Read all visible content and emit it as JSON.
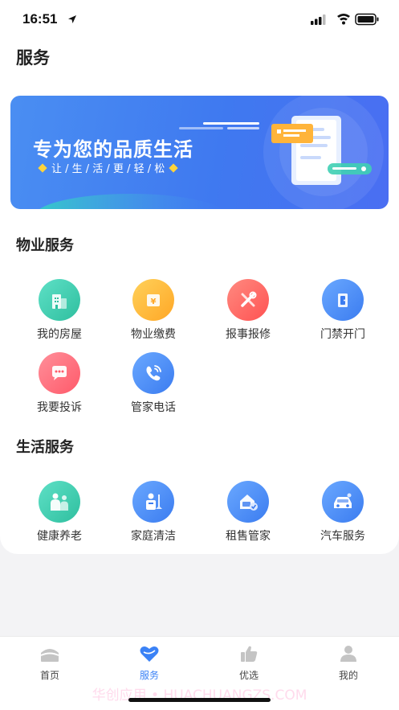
{
  "status": {
    "time": "16:51"
  },
  "page": {
    "title": "服务"
  },
  "banner": {
    "title": "专为您的品质生活",
    "subtitle": "让 / 生 / 活 / 更 / 轻 / 松"
  },
  "property_services": {
    "title": "物业服务",
    "items": [
      {
        "label": "我的房屋",
        "icon": "building-icon",
        "color": "#3fcfb4"
      },
      {
        "label": "物业缴费",
        "icon": "payment-icon",
        "color": "#ffb93a"
      },
      {
        "label": "报事报修",
        "icon": "repair-icon",
        "color": "#ff6b6b"
      },
      {
        "label": "门禁开门",
        "icon": "door-icon",
        "color": "#4a8ef2"
      },
      {
        "label": "我要投诉",
        "icon": "complaint-icon",
        "color": "#ff6b7a"
      },
      {
        "label": "管家电话",
        "icon": "phone-icon",
        "color": "#4a8ef2"
      }
    ]
  },
  "life_services": {
    "title": "生活服务",
    "items": [
      {
        "label": "健康养老",
        "icon": "elderly-care-icon",
        "color": "#3fcfb4"
      },
      {
        "label": "家庭清洁",
        "icon": "cleaning-icon",
        "color": "#4a8ef2"
      },
      {
        "label": "租售管家",
        "icon": "rental-icon",
        "color": "#4a8ef2"
      },
      {
        "label": "汽车服务",
        "icon": "car-icon",
        "color": "#4a8ef2"
      }
    ]
  },
  "tabbar": {
    "items": [
      {
        "label": "首页",
        "icon": "home-icon",
        "active": false
      },
      {
        "label": "服务",
        "icon": "heart-icon",
        "active": true
      },
      {
        "label": "优选",
        "icon": "thumbs-up-icon",
        "active": false
      },
      {
        "label": "我的",
        "icon": "user-icon",
        "active": false
      }
    ]
  },
  "watermark": {
    "text": "华创应用 • HUACHUANGZS.COM"
  },
  "colors": {
    "accent": "#3b82f6",
    "tab_inactive": "#bdbdbd"
  }
}
